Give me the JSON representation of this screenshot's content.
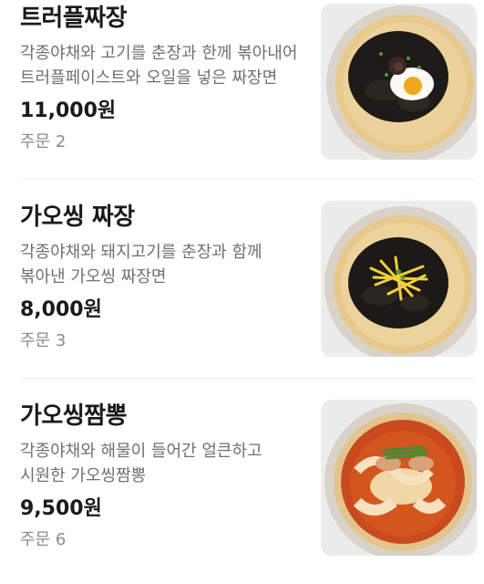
{
  "menu": {
    "items": [
      {
        "name": "트러플짜장",
        "description": "각종야채와 고기를 춘장과 한께 볶아내어 트러플페이스트와 오일을 넣은 짜장면",
        "price": "11,000원",
        "orders": "주문 2",
        "image": "truffle-jjajang-photo"
      },
      {
        "name": "가오씽 짜장",
        "description": "각종야채와 돼지고기를 춘장과 함께 볶아낸 가오씽 짜장면",
        "price": "8,000원",
        "orders": "주문 3",
        "image": "gaossing-jjajang-photo"
      },
      {
        "name": "가오씽짬뽕",
        "description": "각종야채와 해물이 들어간 얼큰하고 시원한 가오씽짬뽕",
        "price": "9,500원",
        "orders": "주문 6",
        "image": "gaossing-jjamppong-photo"
      }
    ]
  },
  "colors": {
    "text": "#1a1a1a",
    "description": "#707070",
    "orders": "#8a8a8a",
    "thumbnail_bg": "#eeeeee",
    "divider": "#ececec"
  }
}
